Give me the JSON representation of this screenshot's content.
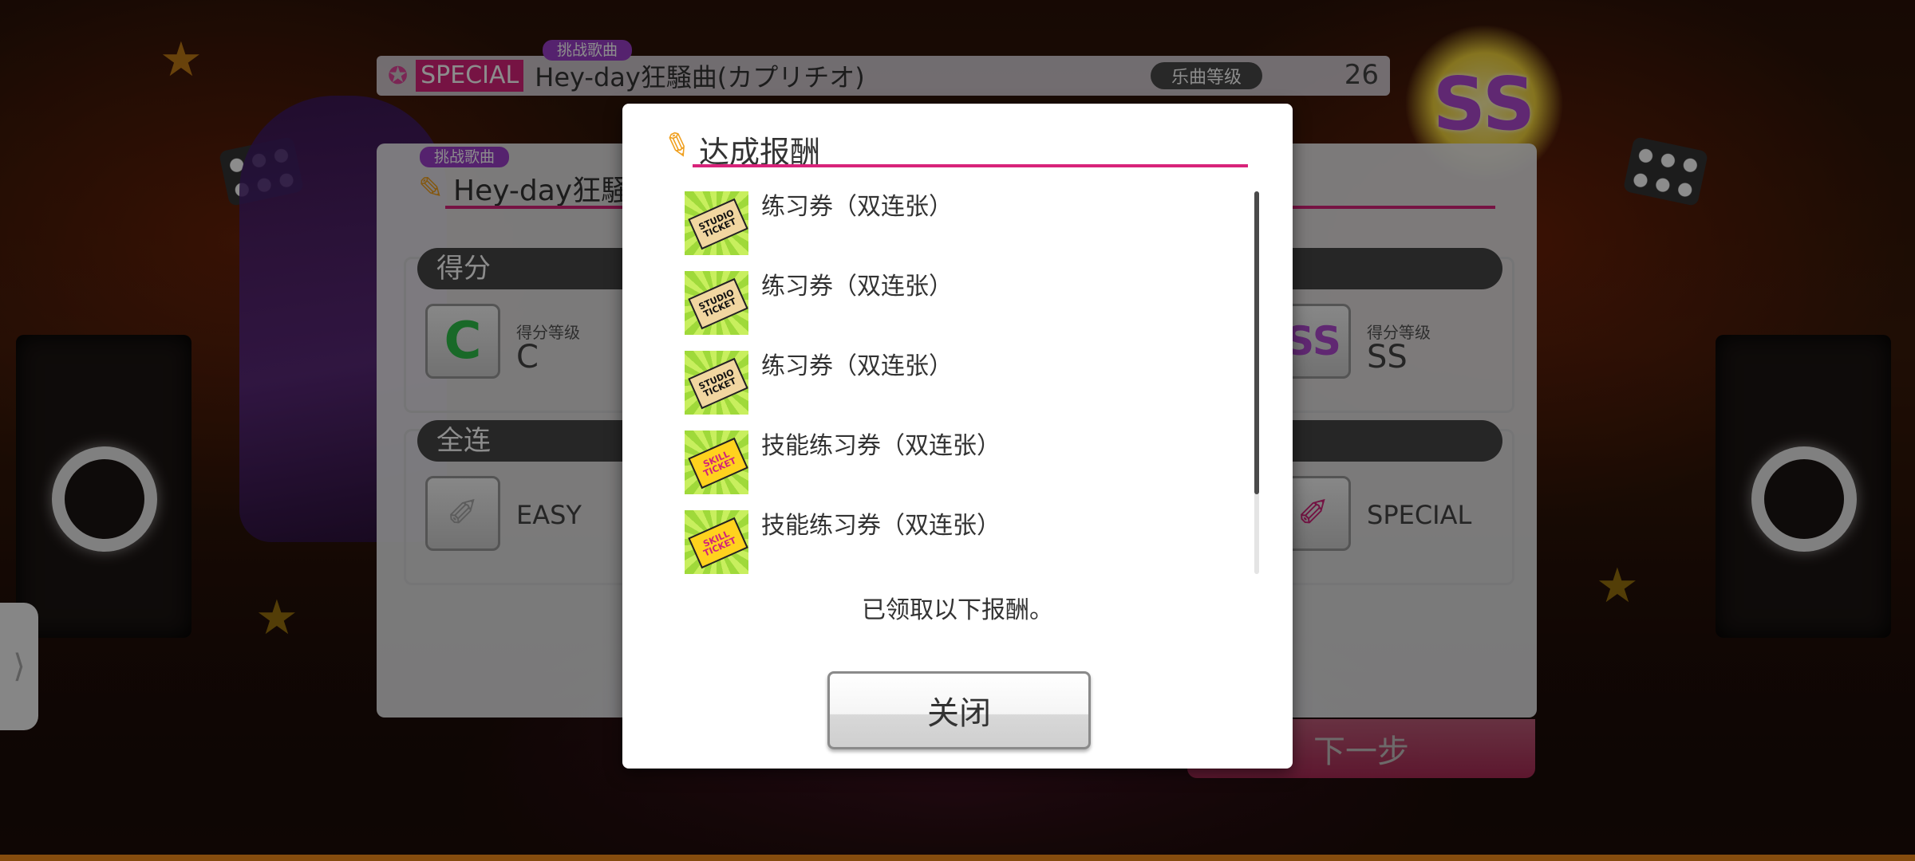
{
  "song_bar": {
    "challenge_tag": "挑战歌曲",
    "difficulty": "SPECIAL",
    "title": "Hey-day狂騒曲(カプリチオ)",
    "level_label": "乐曲等级",
    "level": "26"
  },
  "result_panel": {
    "challenge_tag": "挑战歌曲",
    "title": "Hey-day狂騒",
    "score_section": {
      "header": "得分",
      "left_rank_label": "得分等级",
      "left_rank": "C",
      "right_rank_label": "得分等级",
      "right_rank": "SS"
    },
    "combo_section": {
      "header": "全连",
      "left_difficulty": "EASY",
      "right_difficulty": "SPECIAL"
    },
    "next_button": "下一步"
  },
  "modal": {
    "title": "达成报酬",
    "rewards": [
      {
        "name": "练习券（双连张）",
        "icon": "studio-ticket-icon",
        "ticket_text": "STUDIO TICKET"
      },
      {
        "name": "练习券（双连张）",
        "icon": "studio-ticket-icon",
        "ticket_text": "STUDIO TICKET"
      },
      {
        "name": "练习券（双连张）",
        "icon": "studio-ticket-icon",
        "ticket_text": "STUDIO TICKET"
      },
      {
        "name": "技能练习券（双连张）",
        "icon": "skill-ticket-icon",
        "ticket_text": "SKILL TICKET"
      },
      {
        "name": "技能练习券（双连张）",
        "icon": "skill-ticket-icon",
        "ticket_text": "SKILL TICKET"
      }
    ],
    "message": "已领取以下报酬。",
    "close_button": "关闭"
  },
  "side_tab_icon": "chevron-right-icon",
  "colors": {
    "accent_pink": "#d8237a",
    "challenge_purple": "#9b3fc8",
    "ticket_green": "#9fd93a"
  }
}
